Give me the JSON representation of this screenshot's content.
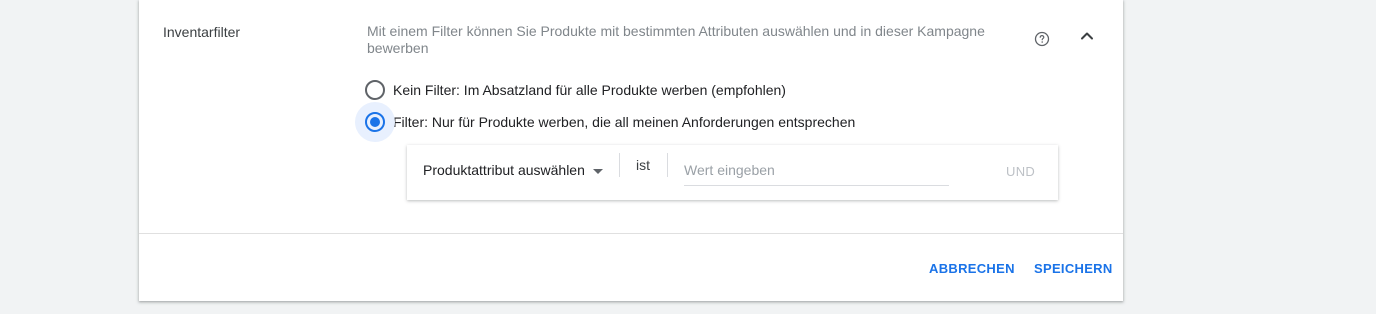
{
  "section": {
    "title": "Inventarfilter",
    "description": "Mit einem Filter können Sie Produkte mit bestimmten Attributen auswählen und in dieser Kampagne bewerben"
  },
  "options": [
    {
      "label": "Kein Filter: Im Absatzland für alle Produkte werben (empfohlen)",
      "selected": false
    },
    {
      "label": "Filter: Nur für Produkte werben, die all meinen Anforderungen entsprechen",
      "selected": true
    }
  ],
  "filter": {
    "attribute_select": "Produktattribut auswählen",
    "operator": "ist",
    "value_placeholder": "Wert eingeben",
    "value": "",
    "and_label": "UND"
  },
  "footer": {
    "cancel_label": "ABBRECHEN",
    "save_label": "SPEICHERN"
  },
  "colors": {
    "accent": "#1a73e8",
    "disabled": "#bdc1c6"
  },
  "icons": {
    "help": "help-circle-icon",
    "collapse": "chevron-up-icon",
    "dropdown": "caret-down-icon"
  }
}
